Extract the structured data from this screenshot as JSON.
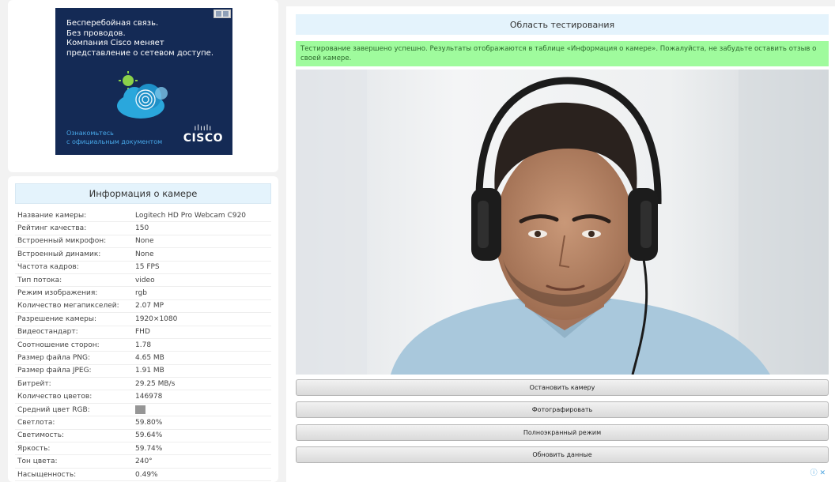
{
  "ad": {
    "lines": [
      "Бесперебойная связь.",
      "Без проводов.",
      "Компания Cisco меняет",
      "представление о сетевом доступе."
    ],
    "link_lines": [
      "Ознакомьтесь",
      "с официальным документом"
    ],
    "logo_bars": "ılıılı",
    "logo_text": "CISCO",
    "ad_choices": "ⓘ ✕"
  },
  "camera_info": {
    "title": "Информация о камере",
    "rows": [
      {
        "label": "Название камеры:",
        "value": "Logitech HD Pro Webcam C920"
      },
      {
        "label": "Рейтинг качества:",
        "value": "150"
      },
      {
        "label": "Встроенный микрофон:",
        "value": "None"
      },
      {
        "label": "Встроенный динамик:",
        "value": "None"
      },
      {
        "label": "Частота кадров:",
        "value": "15 FPS"
      },
      {
        "label": "Тип потока:",
        "value": "video"
      },
      {
        "label": "Режим изображения:",
        "value": "rgb"
      },
      {
        "label": "Количество мегапикселей:",
        "value": "2.07 MP"
      },
      {
        "label": "Разрешение камеры:",
        "value": "1920×1080"
      },
      {
        "label": "Видеостандарт:",
        "value": "FHD"
      },
      {
        "label": "Соотношение сторон:",
        "value": "1.78"
      },
      {
        "label": "Размер файла PNG:",
        "value": "4.65 MB"
      },
      {
        "label": "Размер файла JPEG:",
        "value": "1.91 MB"
      },
      {
        "label": "Битрейт:",
        "value": "29.25 MB/s"
      },
      {
        "label": "Количество цветов:",
        "value": "146978"
      },
      {
        "label": "Средний цвет RGB:",
        "value": ""
      },
      {
        "label": "Светлота:",
        "value": "59.80%"
      },
      {
        "label": "Светимость:",
        "value": "59.64%"
      },
      {
        "label": "Яркость:",
        "value": "59.74%"
      },
      {
        "label": "Тон цвета:",
        "value": "240°"
      },
      {
        "label": "Насыщенность:",
        "value": "0.49%"
      }
    ],
    "avg_color": "#969696"
  },
  "testing": {
    "title": "Область тестирования",
    "status": "Тестирование завершено успешно. Результаты отображаются в таблице «Информация о камере». Пожалуйста, не забудьте оставить отзыв о своей камере.",
    "buttons": {
      "stop": "Остановить камеру",
      "photo": "Фотографировать",
      "fullscreen": "Полноэкранный режим",
      "refresh": "Обновить данные"
    }
  }
}
